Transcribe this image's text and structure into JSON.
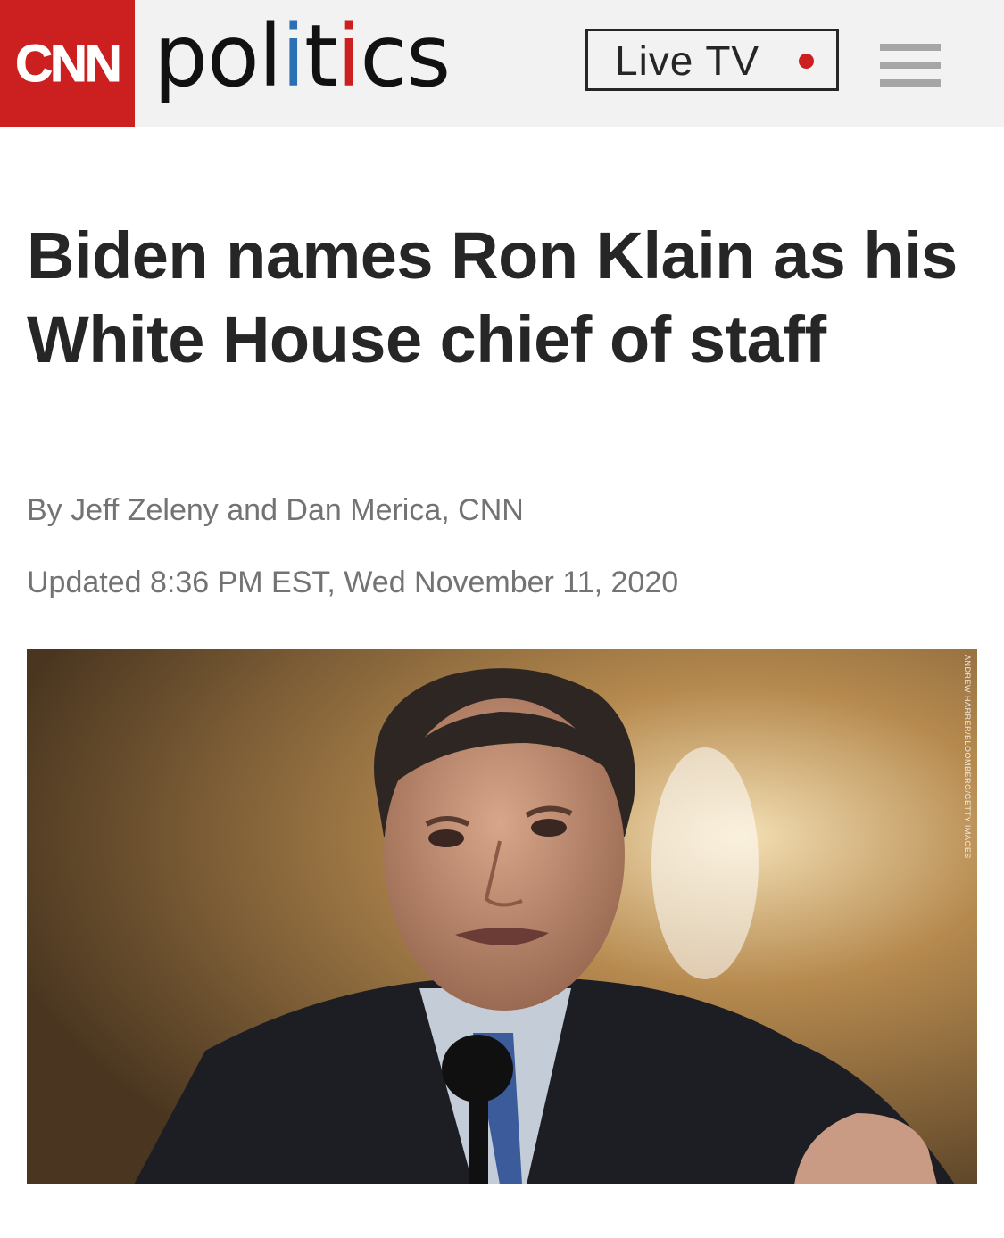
{
  "header": {
    "logo": "CNN",
    "section_parts": [
      "pol",
      "i",
      "t",
      "i",
      "cs"
    ],
    "live_tv_label": "Live TV",
    "colors": {
      "brand_red": "#cc1f1f",
      "accent_blue": "#2b6fb5"
    },
    "menu_icon": "hamburger-menu-icon"
  },
  "article": {
    "headline": "Biden names Ron Klain as his White House chief of staff",
    "byline": "By Jeff Zeleny and Dan Merica, CNN",
    "updated": "Updated 8:36 PM EST, Wed November 11, 2020",
    "photo_credit": "ANDREW HARRER/BLOOMBERG/GETTY IMAGES"
  }
}
